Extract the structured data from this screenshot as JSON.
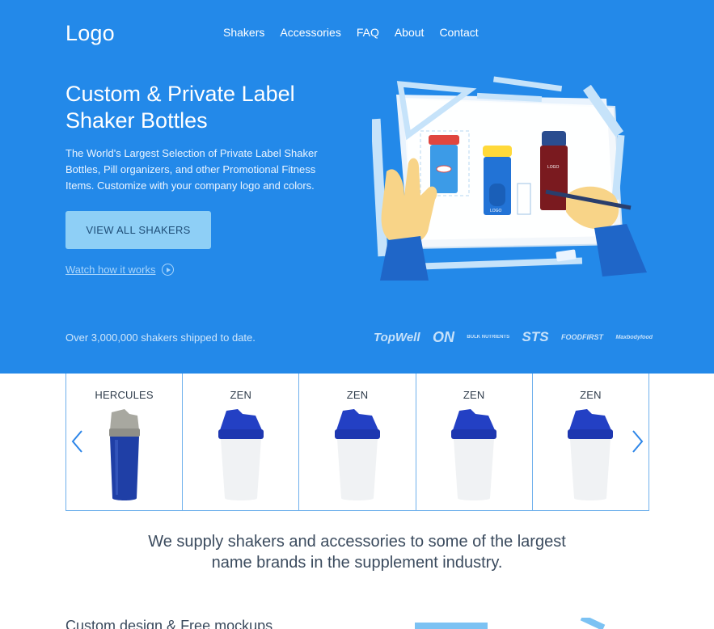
{
  "header": {
    "logo": "Logo",
    "nav": [
      "Shakers",
      "Accessories",
      "FAQ",
      "About",
      "Contact"
    ]
  },
  "hero": {
    "title_line1": "Custom & Private Label",
    "title_line2": "Shaker Bottles",
    "description": "The World's Largest Selection of Private Label Shaker Bottles, Pill organizers, and other Promotional Fitness Items. Customize with your company logo and colors.",
    "cta_label": "VIEW ALL SHAKERS",
    "watch_label": "Watch how it works",
    "shipped_text": "Over 3,000,000 shakers shipped to date.",
    "brands": [
      "TopWell",
      "ON",
      "BULK NUTRIENTS",
      "STS",
      "FOODFIRST",
      "Maxbodyfood"
    ],
    "illustration_labels": [
      "LOGO",
      "LOGO",
      "LOGO"
    ]
  },
  "carousel": {
    "items": [
      {
        "name": "HERCULES"
      },
      {
        "name": "ZEN"
      },
      {
        "name": "ZEN"
      },
      {
        "name": "ZEN"
      },
      {
        "name": "ZEN"
      }
    ]
  },
  "tagline": {
    "line1": "We supply shakers and accessories to some of the largest",
    "line2": "name brands in the supplement industry."
  },
  "next_section": {
    "heading": "Custom design & Free mockups"
  },
  "colors": {
    "hero_bg": "#2389e9",
    "cta_bg": "#8ecff6",
    "card_border": "#6fb0ec",
    "zen_cap": "#2340c4",
    "hercules_body": "#1f3fa6"
  }
}
